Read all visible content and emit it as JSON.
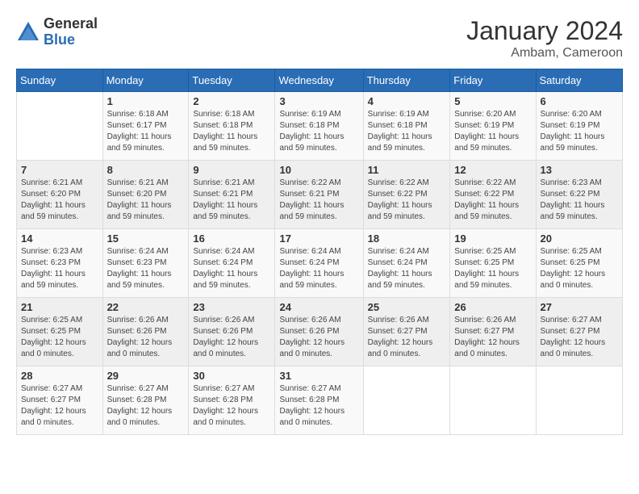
{
  "logo": {
    "general": "General",
    "blue": "Blue"
  },
  "title": "January 2024",
  "subtitle": "Ambam, Cameroon",
  "days_of_week": [
    "Sunday",
    "Monday",
    "Tuesday",
    "Wednesday",
    "Thursday",
    "Friday",
    "Saturday"
  ],
  "weeks": [
    [
      {
        "day": "",
        "info": ""
      },
      {
        "day": "1",
        "info": "Sunrise: 6:18 AM\nSunset: 6:17 PM\nDaylight: 11 hours\nand 59 minutes."
      },
      {
        "day": "2",
        "info": "Sunrise: 6:18 AM\nSunset: 6:18 PM\nDaylight: 11 hours\nand 59 minutes."
      },
      {
        "day": "3",
        "info": "Sunrise: 6:19 AM\nSunset: 6:18 PM\nDaylight: 11 hours\nand 59 minutes."
      },
      {
        "day": "4",
        "info": "Sunrise: 6:19 AM\nSunset: 6:18 PM\nDaylight: 11 hours\nand 59 minutes."
      },
      {
        "day": "5",
        "info": "Sunrise: 6:20 AM\nSunset: 6:19 PM\nDaylight: 11 hours\nand 59 minutes."
      },
      {
        "day": "6",
        "info": "Sunrise: 6:20 AM\nSunset: 6:19 PM\nDaylight: 11 hours\nand 59 minutes."
      }
    ],
    [
      {
        "day": "7",
        "info": "Sunrise: 6:21 AM\nSunset: 6:20 PM\nDaylight: 11 hours\nand 59 minutes."
      },
      {
        "day": "8",
        "info": "Sunrise: 6:21 AM\nSunset: 6:20 PM\nDaylight: 11 hours\nand 59 minutes."
      },
      {
        "day": "9",
        "info": "Sunrise: 6:21 AM\nSunset: 6:21 PM\nDaylight: 11 hours\nand 59 minutes."
      },
      {
        "day": "10",
        "info": "Sunrise: 6:22 AM\nSunset: 6:21 PM\nDaylight: 11 hours\nand 59 minutes."
      },
      {
        "day": "11",
        "info": "Sunrise: 6:22 AM\nSunset: 6:22 PM\nDaylight: 11 hours\nand 59 minutes."
      },
      {
        "day": "12",
        "info": "Sunrise: 6:22 AM\nSunset: 6:22 PM\nDaylight: 11 hours\nand 59 minutes."
      },
      {
        "day": "13",
        "info": "Sunrise: 6:23 AM\nSunset: 6:22 PM\nDaylight: 11 hours\nand 59 minutes."
      }
    ],
    [
      {
        "day": "14",
        "info": "Sunrise: 6:23 AM\nSunset: 6:23 PM\nDaylight: 11 hours\nand 59 minutes."
      },
      {
        "day": "15",
        "info": "Sunrise: 6:24 AM\nSunset: 6:23 PM\nDaylight: 11 hours\nand 59 minutes."
      },
      {
        "day": "16",
        "info": "Sunrise: 6:24 AM\nSunset: 6:24 PM\nDaylight: 11 hours\nand 59 minutes."
      },
      {
        "day": "17",
        "info": "Sunrise: 6:24 AM\nSunset: 6:24 PM\nDaylight: 11 hours\nand 59 minutes."
      },
      {
        "day": "18",
        "info": "Sunrise: 6:24 AM\nSunset: 6:24 PM\nDaylight: 11 hours\nand 59 minutes."
      },
      {
        "day": "19",
        "info": "Sunrise: 6:25 AM\nSunset: 6:25 PM\nDaylight: 11 hours\nand 59 minutes."
      },
      {
        "day": "20",
        "info": "Sunrise: 6:25 AM\nSunset: 6:25 PM\nDaylight: 12 hours\nand 0 minutes."
      }
    ],
    [
      {
        "day": "21",
        "info": "Sunrise: 6:25 AM\nSunset: 6:25 PM\nDaylight: 12 hours\nand 0 minutes."
      },
      {
        "day": "22",
        "info": "Sunrise: 6:26 AM\nSunset: 6:26 PM\nDaylight: 12 hours\nand 0 minutes."
      },
      {
        "day": "23",
        "info": "Sunrise: 6:26 AM\nSunset: 6:26 PM\nDaylight: 12 hours\nand 0 minutes."
      },
      {
        "day": "24",
        "info": "Sunrise: 6:26 AM\nSunset: 6:26 PM\nDaylight: 12 hours\nand 0 minutes."
      },
      {
        "day": "25",
        "info": "Sunrise: 6:26 AM\nSunset: 6:27 PM\nDaylight: 12 hours\nand 0 minutes."
      },
      {
        "day": "26",
        "info": "Sunrise: 6:26 AM\nSunset: 6:27 PM\nDaylight: 12 hours\nand 0 minutes."
      },
      {
        "day": "27",
        "info": "Sunrise: 6:27 AM\nSunset: 6:27 PM\nDaylight: 12 hours\nand 0 minutes."
      }
    ],
    [
      {
        "day": "28",
        "info": "Sunrise: 6:27 AM\nSunset: 6:27 PM\nDaylight: 12 hours\nand 0 minutes."
      },
      {
        "day": "29",
        "info": "Sunrise: 6:27 AM\nSunset: 6:28 PM\nDaylight: 12 hours\nand 0 minutes."
      },
      {
        "day": "30",
        "info": "Sunrise: 6:27 AM\nSunset: 6:28 PM\nDaylight: 12 hours\nand 0 minutes."
      },
      {
        "day": "31",
        "info": "Sunrise: 6:27 AM\nSunset: 6:28 PM\nDaylight: 12 hours\nand 0 minutes."
      },
      {
        "day": "",
        "info": ""
      },
      {
        "day": "",
        "info": ""
      },
      {
        "day": "",
        "info": ""
      }
    ]
  ]
}
